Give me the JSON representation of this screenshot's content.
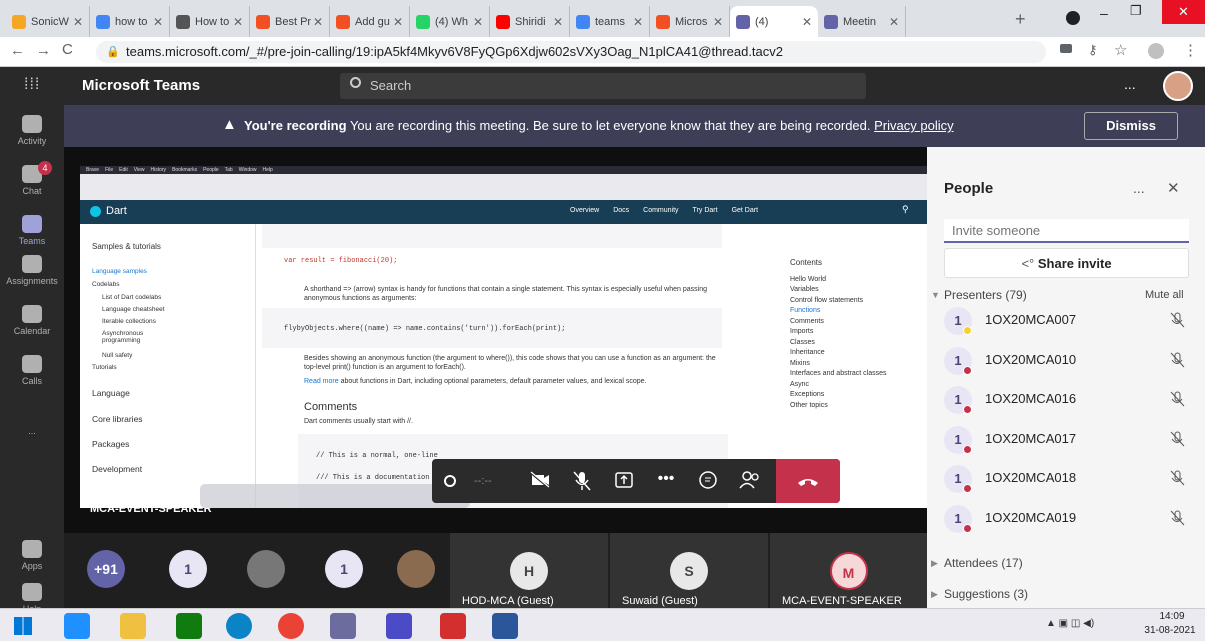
{
  "browser": {
    "tabs": [
      {
        "label": "SonicW",
        "color": "#f5a623"
      },
      {
        "label": "how to",
        "color": "#4285f4"
      },
      {
        "label": "How to",
        "color": "#555"
      },
      {
        "label": "Best Pr",
        "color": "#f25022"
      },
      {
        "label": "Add gu",
        "color": "#f25022"
      },
      {
        "label": "(4) Wh",
        "color": "#25d366"
      },
      {
        "label": "Shiridi",
        "color": "#ff0000"
      },
      {
        "label": "teams",
        "color": "#4285f4"
      },
      {
        "label": "Micros",
        "color": "#f25022"
      },
      {
        "label": "(4)",
        "color": "#6264a7"
      },
      {
        "label": "Meetin",
        "color": "#6264a7"
      }
    ],
    "new_tab": "+",
    "url": "teams.microsoft.com/_#/pre-join-calling/19:ipA5kf4Mkyv6V8FyQGp6Xdjw602sVXy3Oag_N1plCA41@thread.tacv2"
  },
  "teams": {
    "app_title": "Microsoft Teams",
    "search_placeholder": "Search",
    "more": "...",
    "rail": [
      {
        "label": "Activity",
        "icon": "bell-icon"
      },
      {
        "label": "Chat",
        "icon": "chat-icon",
        "badge": "4"
      },
      {
        "label": "Teams",
        "icon": "teams-icon"
      },
      {
        "label": "Assignments",
        "icon": "assignments-icon"
      },
      {
        "label": "Calendar",
        "icon": "calendar-icon"
      },
      {
        "label": "Calls",
        "icon": "phone-icon"
      },
      {
        "label": "...",
        "icon": "more-icon"
      },
      {
        "label": "Apps",
        "icon": "apps-icon"
      },
      {
        "label": "Help",
        "icon": "help-icon"
      }
    ],
    "recording": {
      "bold": "You're recording",
      "text": "You are recording this meeting. Be sure to let everyone know that they are being recorded.",
      "link": "Privacy policy",
      "dismiss": "Dismiss"
    },
    "stage_label": "MCA-EVENT-SPEAKER",
    "call_timer": "--:--",
    "people": {
      "title": "People",
      "more": "...",
      "close": "✕",
      "invite_placeholder": "Invite someone",
      "share_invite": "Share invite",
      "presenters_label": "Presenters (79)",
      "mute_all": "Mute all",
      "presenters": [
        {
          "initial": "1",
          "name": "1OX20MCA007",
          "status_color": "#f8d22a"
        },
        {
          "initial": "1",
          "name": "1OX20MCA010",
          "status_color": "#c4314b"
        },
        {
          "initial": "1",
          "name": "1OX20MCA016",
          "status_color": "#c4314b"
        },
        {
          "initial": "1",
          "name": "1OX20MCA017",
          "status_color": "#c4314b"
        },
        {
          "initial": "1",
          "name": "1OX20MCA018",
          "status_color": "#c4314b"
        },
        {
          "initial": "1",
          "name": "1OX20MCA019",
          "status_color": "#c4314b"
        }
      ],
      "attendees_label": "Attendees (17)",
      "suggestions_label": "Suggestions (3)"
    },
    "bottom_tiles": [
      {
        "initial": "+91",
        "color": "#6264a7",
        "text_color": "#fff"
      },
      {
        "initial": "1",
        "color": "#e8e6f4",
        "text_color": "#464775"
      },
      {
        "initial": "",
        "color": "#777",
        "text_color": "#fff"
      },
      {
        "initial": "1",
        "color": "#e8e6f4",
        "text_color": "#464775"
      },
      {
        "initial": "",
        "color": "#8b6b4f",
        "text_color": "#fff"
      },
      {
        "initial": "H",
        "color": "#e8e8e8",
        "text_color": "#444",
        "name": "HOD-MCA (Guest)"
      },
      {
        "initial": "S",
        "color": "#e8e8e8",
        "text_color": "#444",
        "name": "Suwaid (Guest)"
      },
      {
        "initial": "M",
        "color": "#f7d8d8",
        "text_color": "#c4314b",
        "name": "MCA-EVENT-SPEAKER"
      }
    ]
  },
  "shared": {
    "menu": [
      "Brave",
      "File",
      "Edit",
      "View",
      "History",
      "Bookmarks",
      "People",
      "Tab",
      "Window",
      "Help"
    ],
    "site_title": "Dart",
    "nav": [
      "Overview",
      "Docs",
      "Community",
      "Try Dart",
      "Get Dart"
    ],
    "left_nav": [
      "Samples & tutorials",
      "Language samples",
      "Codelabs",
      "List of Dart codelabs",
      "Language cheatsheet",
      "Iterable collections",
      "Asynchronous programming",
      "Null safety",
      "Tutorials",
      "Language",
      "Core libraries",
      "Packages",
      "Development"
    ],
    "code1": "var result = fibonacci(20);",
    "para1": "A shorthand => (arrow) syntax is handy for functions that contain a single statement. This syntax is especially useful when passing anonymous functions as arguments:",
    "code2": "flybyObjects.where((name) => name.contains('turn')).forEach(print);",
    "para2": "Besides showing an anonymous function (the argument to where()), this code shows that you can use a function as an argument: the top-level print() function is an argument to forEach().",
    "para3_link": "Read more",
    "para3": "about functions in Dart, including optional parameters, default parameter values, and lexical scope.",
    "comments_h": "Comments",
    "comments_p": "Dart comments usually start with //.",
    "code3": "// This is a normal, one-line",
    "code4": "/// This is a documentation c",
    "toc_title": "Contents",
    "toc": [
      "Hello World",
      "Variables",
      "Control flow statements",
      "Functions",
      "Comments",
      "Imports",
      "Classes",
      "Inheritance",
      "Mixins",
      "Interfaces and abstract classes",
      "Async",
      "Exceptions",
      "Other topics"
    ]
  },
  "taskbar": {
    "time": "14:09",
    "date": "31-08-2021"
  }
}
